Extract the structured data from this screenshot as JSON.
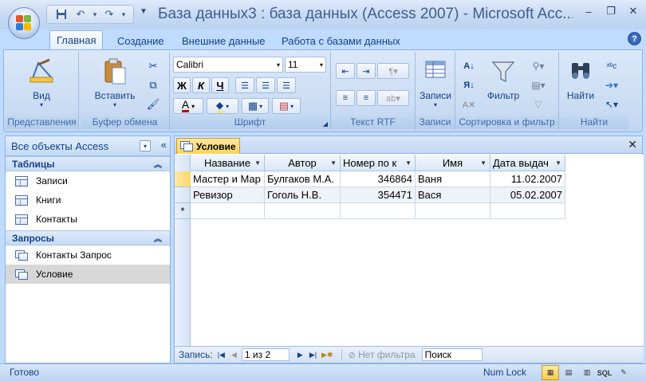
{
  "window": {
    "title": "База данных3 : база данных (Access 2007) - Microsoft Acc...",
    "minimize_glyph": "–",
    "maximize_glyph": "❐",
    "close_glyph": "✕"
  },
  "qat": {
    "undo_glyph": "↶",
    "redo_glyph": "↷",
    "dropdown_glyph": "▾",
    "customize_glyph": "▼"
  },
  "tabs": [
    {
      "label": "Главная"
    },
    {
      "label": "Создание"
    },
    {
      "label": "Внешние данные"
    },
    {
      "label": "Работа с базами данных"
    }
  ],
  "help_glyph": "?",
  "ribbon": {
    "groups": {
      "views": {
        "label": "Представления",
        "view_button": "Вид"
      },
      "clipboard": {
        "label": "Буфер обмена",
        "paste_button": "Вставить"
      },
      "font": {
        "label": "Шрифт",
        "font_name": "Calibri",
        "font_size": "11",
        "bold": "Ж",
        "italic": "К",
        "underline": "Ч",
        "font_color": "A"
      },
      "rtf": {
        "label": "Текст RTF"
      },
      "records": {
        "label": "Записи",
        "records_button": "Записи"
      },
      "sort_filter": {
        "label": "Сортировка и фильтр",
        "filter_button": "Фильтр"
      },
      "find": {
        "label": "Найти",
        "find_button": "Найти"
      }
    },
    "accent_color": "#c00000"
  },
  "nav_pane": {
    "header": "Все объекты Access",
    "sections": [
      {
        "title": "Таблицы",
        "items": [
          "Записи",
          "Книги",
          "Контакты"
        ]
      },
      {
        "title": "Запросы",
        "items": [
          "Контакты Запрос",
          "Условие"
        ]
      }
    ],
    "selected_item": "Условие"
  },
  "document": {
    "tab_label": "Условие",
    "columns": [
      "Название",
      "Автор",
      "Номер по к",
      "Имя",
      "Дата выдач"
    ],
    "rows": [
      [
        "Мастер и Мар",
        "Булгаков М.А.",
        "346864",
        "Ваня",
        "11.02.2007"
      ],
      [
        "Ревизор",
        "Гоголь Н.В.",
        "354471",
        "Вася",
        "05.02.2007"
      ]
    ],
    "new_row_marker": "*"
  },
  "record_nav": {
    "label": "Запись:",
    "position": "1 из 2",
    "filter": "Нет фильтра",
    "search": "Поиск"
  },
  "status_bar": {
    "status": "Готово",
    "num_lock": "Num Lock",
    "sql_label": "SQL"
  }
}
